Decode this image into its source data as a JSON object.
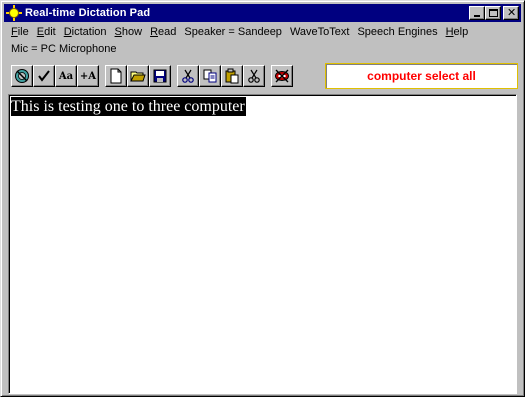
{
  "window": {
    "title": "Real-time Dictation Pad"
  },
  "menu": {
    "row1": [
      {
        "label": "File",
        "accel": "F",
        "rest": "ile"
      },
      {
        "label": "Edit",
        "accel": "E",
        "rest": "dit"
      },
      {
        "label": "Dictation",
        "accel": "D",
        "rest": "ictation"
      },
      {
        "label": "Show",
        "accel": "S",
        "rest": "how"
      },
      {
        "label": "Read",
        "accel": "R",
        "rest": "ead"
      },
      {
        "label": "Speaker = Sandeep"
      },
      {
        "label": "WaveToText"
      },
      {
        "label": "Speech Engines"
      },
      {
        "label": "Help",
        "accel": "H",
        "rest": "elp"
      }
    ],
    "row2": [
      {
        "label": "Mic = PC Microphone"
      }
    ]
  },
  "toolbar": {
    "buttons": [
      {
        "icon": "no-mic-icon"
      },
      {
        "icon": "checkmark-icon"
      },
      {
        "icon": "font-icon",
        "text": "Aa"
      },
      {
        "icon": "font-size-icon",
        "text": "+A"
      },
      {
        "icon": "new-document-icon"
      },
      {
        "icon": "open-folder-icon"
      },
      {
        "icon": "save-icon"
      },
      {
        "icon": "cut-icon"
      },
      {
        "icon": "copy-icon"
      },
      {
        "icon": "paste-icon"
      },
      {
        "icon": "delete-icon"
      },
      {
        "icon": "no-speech-icon"
      }
    ],
    "status_text": "computer select all",
    "status_color": "#ff0000"
  },
  "editor": {
    "content": "This is testing one to three computer",
    "selected": true
  }
}
